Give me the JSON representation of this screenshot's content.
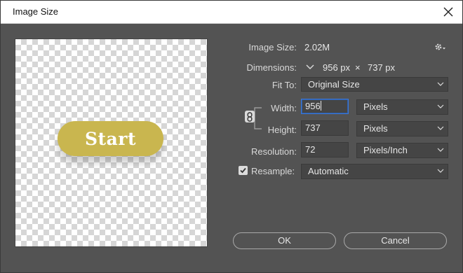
{
  "dialog": {
    "title": "Image Size"
  },
  "preview": {
    "button_text": "Start",
    "button_color": "#c9b64f"
  },
  "info": {
    "image_size_label": "Image Size:",
    "image_size_value": "2.02M",
    "dimensions_label": "Dimensions:",
    "dimensions_width": "956 px",
    "dimensions_separator": "×",
    "dimensions_height": "737 px"
  },
  "fit_to": {
    "label": "Fit To:",
    "value": "Original Size"
  },
  "width": {
    "label": "Width:",
    "value": "956",
    "unit": "Pixels"
  },
  "height": {
    "label": "Height:",
    "value": "737",
    "unit": "Pixels"
  },
  "resolution": {
    "label": "Resolution:",
    "value": "72",
    "unit": "Pixels/Inch"
  },
  "resample": {
    "label": "Resample:",
    "checked": true,
    "value": "Automatic"
  },
  "buttons": {
    "ok": "OK",
    "cancel": "Cancel"
  },
  "icons": {
    "settings": "gear-icon",
    "close": "close-icon",
    "link": "link-icon"
  }
}
